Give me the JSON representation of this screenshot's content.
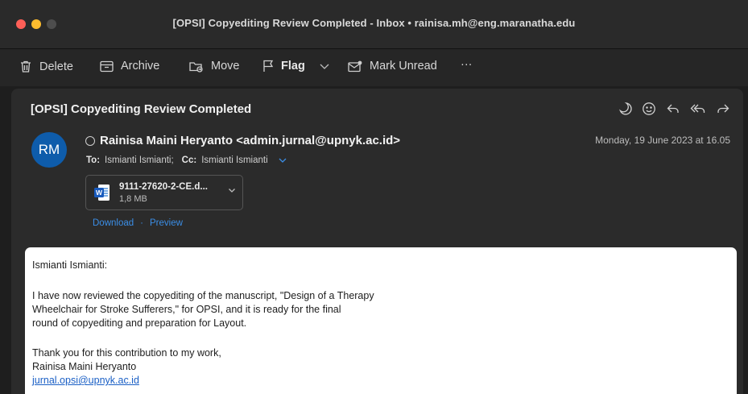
{
  "window": {
    "title": "[OPSI] Copyediting Review Completed - Inbox • rainisa.mh@eng.maranatha.edu"
  },
  "toolbar": {
    "delete": "Delete",
    "archive": "Archive",
    "move": "Move",
    "flag": "Flag",
    "mark_unread": "Mark Unread",
    "more": "···"
  },
  "message": {
    "subject": "[OPSI] Copyediting Review Completed",
    "avatar_initials": "RM",
    "sender": "Rainisa Maini Heryanto <admin.jurnal@upnyk.ac.id>",
    "date": "Monday, 19 June 2023 at 16.05",
    "to_label": "To:",
    "to": "Ismianti Ismianti;",
    "cc_label": "Cc:",
    "cc": "Ismianti Ismianti",
    "attachment": {
      "name": "9111-27620-2-CE.d...",
      "size": "1,8 MB"
    },
    "download": "Download",
    "dot": "·",
    "preview": "Preview"
  },
  "body": {
    "greeting": "Ismianti Ismianti:",
    "para1_line1": "I have now reviewed the copyediting of the manuscript, \"Design of a Therapy",
    "para1_line2": "Wheelchair for Stroke Sufferers,\" for OPSI, and it is ready for the final",
    "para1_line3": "round of copyediting and preparation for Layout.",
    "thanks": "Thank you for this contribution to my work,",
    "signature_name": "Rainisa Maini Heryanto",
    "signature_email": "jurnal.opsi@upnyk.ac.id"
  },
  "colors": {
    "accent": "#3b8ee6",
    "avatar": "#0e5cab",
    "close": "#fe5f57",
    "minimize": "#febc2e"
  },
  "icons": [
    "trash-icon",
    "archive-icon",
    "move-icon",
    "flag-icon",
    "chevron-down-icon",
    "mark-unread-icon",
    "more-icon",
    "snooze-icon",
    "emoji-icon",
    "reply-icon",
    "reply-all-icon",
    "forward-icon",
    "word-file-icon"
  ]
}
